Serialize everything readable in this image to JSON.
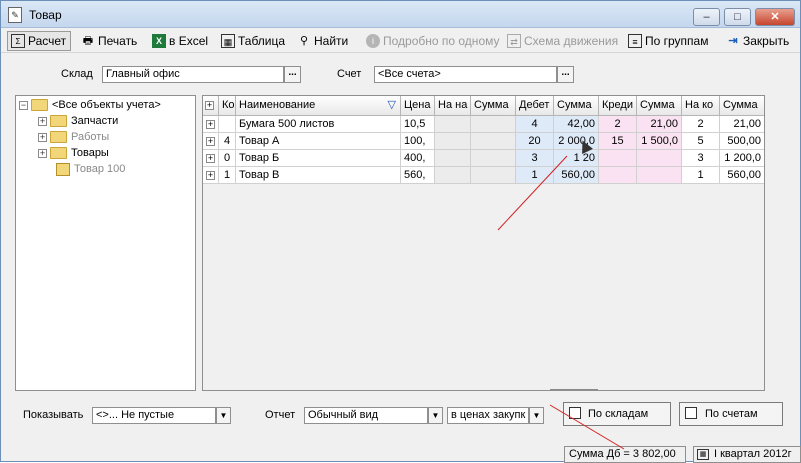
{
  "window": {
    "title": "Товар",
    "min_label": "–",
    "max_label": "□",
    "close_label": "✕"
  },
  "toolbar": {
    "raschet": "Расчет",
    "print": "Печать",
    "excel": "в Excel",
    "table": "Таблица",
    "find": "Найти",
    "detail": "Подробно по одному",
    "scheme": "Схема движения",
    "groups": "По группам",
    "close": "Закрыть"
  },
  "filters": {
    "sklad_label": "Склад",
    "sklad_value": "Главный офис",
    "schet_label": "Счет",
    "schet_value": "<Все счета>",
    "dots": "..."
  },
  "tree": {
    "root": "<Все объекты учета>",
    "items": [
      "Запчасти",
      "Работы",
      "Товары"
    ],
    "leaf": "Товар 100"
  },
  "grid": {
    "headers": [
      "Ко",
      "Наименование",
      "Цена",
      "На на",
      "Сумма",
      "Дебет",
      "Сумма",
      "Креди",
      "Сумма",
      "На ко",
      "Сумма"
    ],
    "rows": [
      {
        "ko": "",
        "name": "Бумага 500 листов",
        "price": "10,5",
        "nach": "",
        "nach_sum": "",
        "debit": "4",
        "debit_sum": "42,00",
        "credit": "2",
        "credit_sum": "21,00",
        "end": "2",
        "end_sum": "21,00"
      },
      {
        "ko": "4",
        "name": "Товар А",
        "price": "100,",
        "nach": "",
        "nach_sum": "",
        "debit": "20",
        "debit_sum": "2 000,0",
        "credit": "15",
        "credit_sum": "1 500,0",
        "end": "5",
        "end_sum": "500,00"
      },
      {
        "ko": "0",
        "name": "Товар Б",
        "price": "400,",
        "nach": "",
        "nach_sum": "",
        "debit": "3",
        "debit_sum": "1 20",
        "credit": "",
        "credit_sum": "",
        "end": "3",
        "end_sum": "1 200,0"
      },
      {
        "ko": "1",
        "name": "Товар В",
        "price": "560,",
        "nach": "",
        "nach_sum": "",
        "debit": "1",
        "debit_sum": "560,00",
        "credit": "",
        "credit_sum": "",
        "end": "1",
        "end_sum": "560,00"
      }
    ]
  },
  "bottom": {
    "show_label": "Показывать",
    "show_value": "<>...    Не пустые",
    "report_label": "Отчет",
    "report_value": "Обычный вид",
    "price_value": "в ценах закупк",
    "by_warehouse": "По складам",
    "by_account": "По счетам"
  },
  "status": {
    "sum": "Сумма Дб = 3 802,00",
    "period": "I квартал 2012г"
  },
  "colors": {
    "debit_bg": "#dfeaf8",
    "credit_bg": "#fbe2f2",
    "annotation_line": "#d32020"
  }
}
